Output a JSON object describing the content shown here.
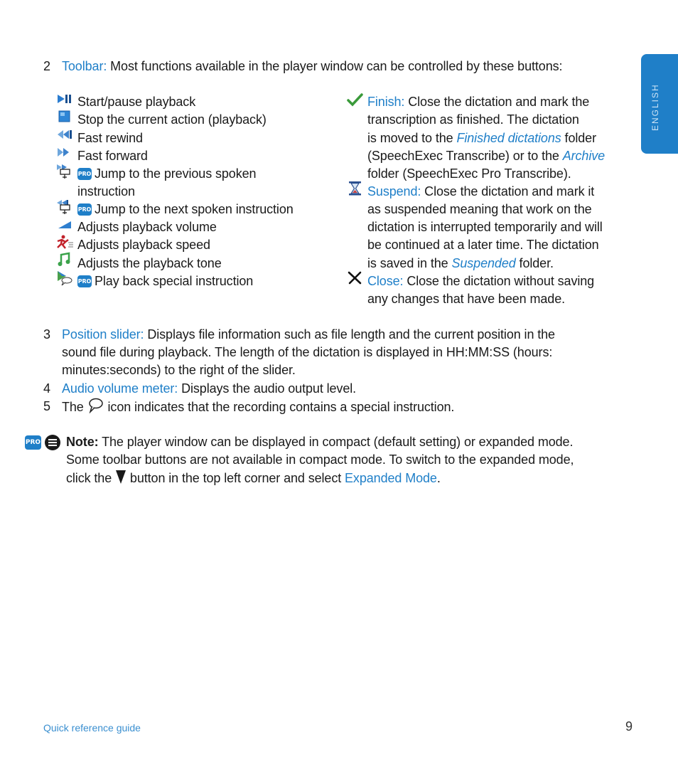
{
  "side_tab": {
    "label": "ENGLISH"
  },
  "item2": {
    "number": "2",
    "term": "Toolbar:",
    "text": " Most functions available in the player window can be controlled by these buttons:"
  },
  "left_buttons": [
    {
      "icon": "start-pause-icon",
      "text": "Start/pause playback"
    },
    {
      "icon": "stop-icon",
      "text": "Stop the current action (playback)"
    },
    {
      "icon": "fast-rewind-icon",
      "text": "Fast rewind"
    },
    {
      "icon": "fast-forward-icon",
      "text": "Fast forward"
    },
    {
      "icon": "jump-previous-instruction-icon",
      "badge": "PRO",
      "text": "Jump to the previous spoken",
      "text2": "instruction"
    },
    {
      "icon": "jump-next-instruction-icon",
      "badge": "PRO",
      "text": "Jump to the next spoken instruction"
    },
    {
      "icon": "volume-icon",
      "text": "Adjusts playback volume"
    },
    {
      "icon": "speed-icon",
      "text": "Adjusts playback speed"
    },
    {
      "icon": "tone-icon",
      "text": "Adjusts the playback tone"
    },
    {
      "icon": "play-special-instruction-icon",
      "badge": "PRO",
      "text": "Play back special instruction"
    }
  ],
  "right_buttons": {
    "finish": {
      "term": "Finish:",
      "l1": " Close the dictation and mark the",
      "l2": "transcription as finished. The dictation",
      "l3a": "is moved to the ",
      "l3link": "Finished dictations",
      "l3b": " folder",
      "l4a": "(SpeechExec Transcribe) or to the ",
      "l4link": "Archive",
      "l5": "folder (SpeechExec Pro Transcribe)."
    },
    "suspend": {
      "term": "Suspend:",
      "l1": " Close the dictation and mark it",
      "l2": "as suspended meaning that work on the",
      "l3": "dictation is interrupted temporarily and will",
      "l4": "be continued at a later time. The dictation",
      "l5a": "is saved in the ",
      "l5link": "Suspended",
      "l5b": " folder."
    },
    "close": {
      "term": "Close:",
      "l1": " Close the dictation without saving",
      "l2": "any changes that have been made."
    }
  },
  "item3": {
    "number": "3",
    "term": "Position slider:",
    "l1": " Displays file information such as file length and the current position in the",
    "l2": "sound file during playback. The length of the dictation is displayed in HH:MM:SS (hours:",
    "l3": "minutes:seconds) to the right of the slider."
  },
  "item4": {
    "number": "4",
    "term": "Audio volume meter:",
    "text": " Displays the audio output level."
  },
  "item5": {
    "number": "5",
    "pre": "The ",
    "post": " icon indicates that the recording contains a special instruction."
  },
  "note": {
    "badge": "PRO",
    "label": "Note:",
    "l1": " The player window can be displayed in compact (default setting) or expanded mode.",
    "l2": "Some toolbar buttons are not available in compact mode. To switch to the expanded mode,",
    "l3a": "click the ",
    "l3b": " button in the top left corner and select ",
    "l3link": "Expanded Mode",
    "l3c": "."
  },
  "footer": {
    "guide_label": "Quick reference guide",
    "page_number": "9"
  }
}
